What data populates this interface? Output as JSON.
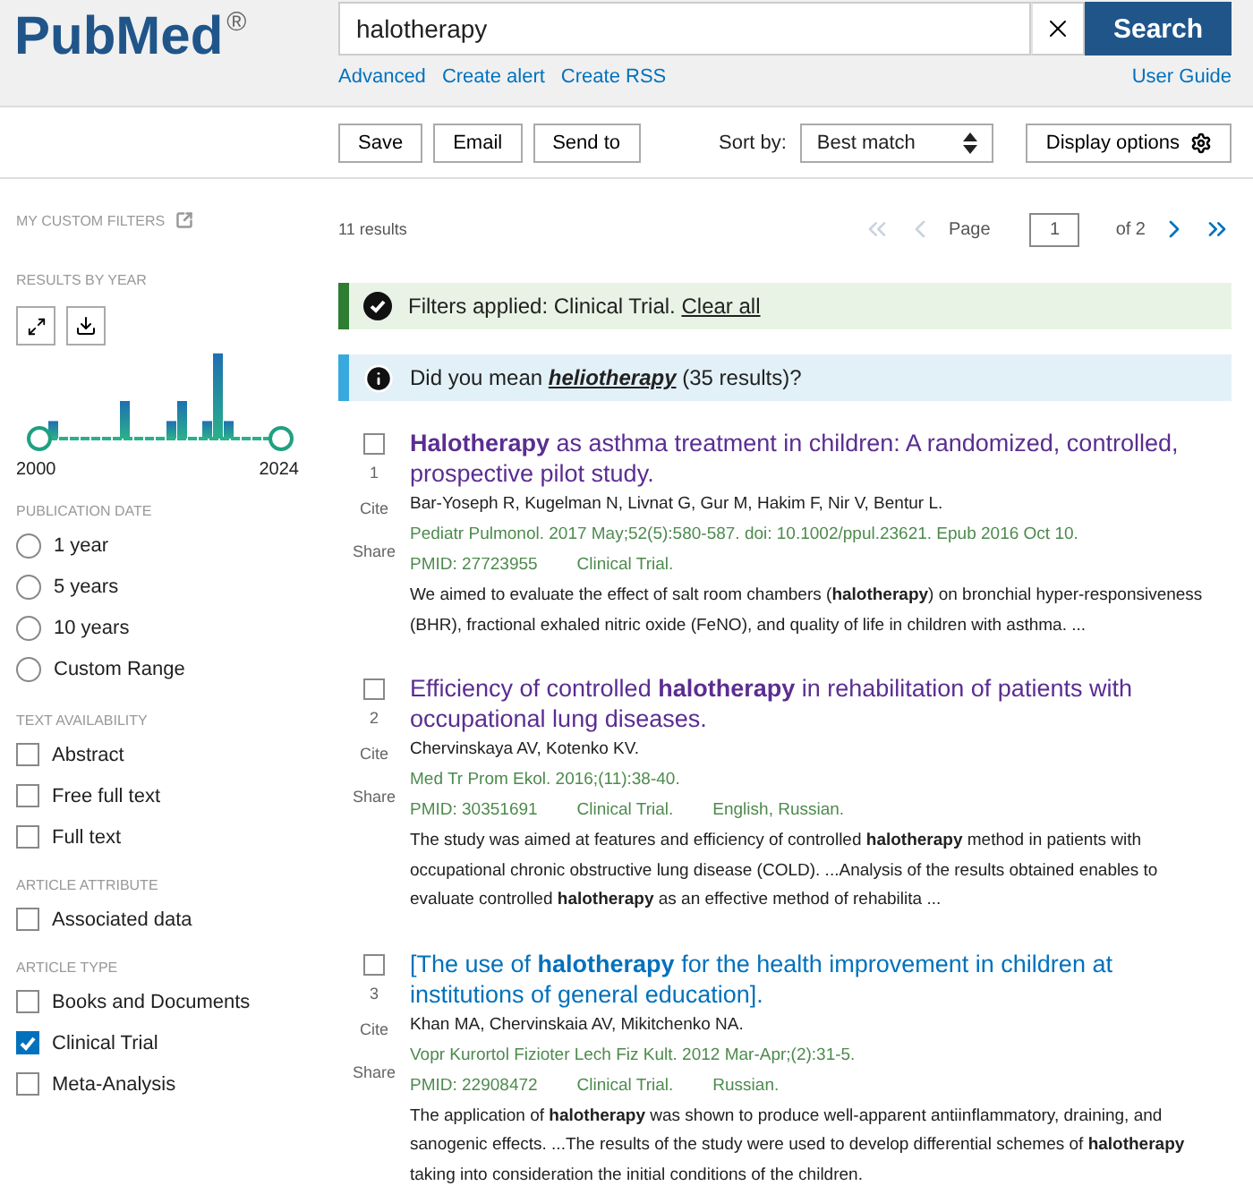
{
  "header": {
    "logo": "PubMed",
    "logo_mark": "®",
    "search": {
      "value": "halotherapy"
    },
    "search_button": "Search",
    "links": [
      "Advanced",
      "Create alert",
      "Create RSS"
    ],
    "user_guide": "User Guide"
  },
  "toolbar": {
    "buttons": [
      "Save",
      "Email",
      "Send to"
    ],
    "sort": {
      "label": "Sort by:",
      "value": "Best match"
    },
    "display_options": "Display options"
  },
  "sidebar": {
    "custom_filters": "MY CUSTOM FILTERS",
    "results_by_year": {
      "title": "RESULTS BY YEAR",
      "start": "2000",
      "end": "2024"
    },
    "sections": [
      {
        "title": "PUBLICATION DATE",
        "kind": "radio",
        "items": [
          {
            "label": "1 year",
            "selected": false
          },
          {
            "label": "5 years",
            "selected": false
          },
          {
            "label": "10 years",
            "selected": false
          },
          {
            "label": "Custom Range",
            "selected": false
          }
        ]
      },
      {
        "title": "TEXT AVAILABILITY",
        "kind": "checkbox",
        "items": [
          {
            "label": "Abstract",
            "checked": false
          },
          {
            "label": "Free full text",
            "checked": false
          },
          {
            "label": "Full text",
            "checked": false
          }
        ]
      },
      {
        "title": "ARTICLE ATTRIBUTE",
        "kind": "checkbox",
        "items": [
          {
            "label": "Associated data",
            "checked": false
          }
        ]
      },
      {
        "title": "ARTICLE TYPE",
        "kind": "checkbox",
        "items": [
          {
            "label": "Books and Documents",
            "checked": false
          },
          {
            "label": "Clinical Trial",
            "checked": true
          },
          {
            "label": "Meta-Analysis",
            "checked": false
          }
        ]
      }
    ]
  },
  "main": {
    "results_count": "11 results",
    "pagination": {
      "label": "Page",
      "value": "1",
      "total": "of 2",
      "first_disabled": true,
      "last_disabled": false
    },
    "filters_notice": {
      "text": "Filters applied: Clinical Trial.",
      "link": "Clear all"
    },
    "suggestion": {
      "before": "Did you mean",
      "term": "heliotherapy",
      "after": "(35 results)?"
    },
    "results": [
      {
        "number": "1",
        "selected": false,
        "visited": true,
        "title": "**Halotherapy** as asthma treatment in children: A randomized, controlled, prospective pilot study.",
        "authors": "Bar-Yoseph R, Kugelman N, Livnat G, Gur M, Hakim F, Nir V, Bentur L.",
        "citation": "Pediatr Pulmonol. 2017 May;52(5):580-587. doi: 10.1002/ppul.23621. Epub 2016 Oct 10.",
        "tags": [
          "PMID: 27723955",
          "Clinical Trial."
        ],
        "snippet": "We aimed to evaluate the effect of salt room chambers (**halotherapy**) on bronchial hyper-responsiveness (BHR), fractional exhaled nitric oxide (FeNO), and quality of life in children with asthma. ...",
        "actions": [
          "Cite",
          "Share"
        ]
      },
      {
        "number": "2",
        "selected": false,
        "visited": true,
        "title": "Efficiency of controlled **halotherapy** in rehabilitation of patients with occupational lung diseases.",
        "authors": "Chervinskaya AV, Kotenko KV.",
        "citation": "Med Tr Prom Ekol. 2016;(11):38-40.",
        "tags": [
          "PMID: 30351691",
          "Clinical Trial.",
          "English, Russian."
        ],
        "snippet": "The study was aimed at features and efficiency of controlled **halotherapy** method in patients with occupational chronic obstructive lung disease (COLD). ...Analysis of the results obtained enables to evaluate controlled **halotherapy** as an effective method of rehabilita ...",
        "actions": [
          "Cite",
          "Share"
        ]
      },
      {
        "number": "3",
        "selected": false,
        "visited": false,
        "title": "[The use of **halotherapy** for the health improvement in children at institutions of general education].",
        "authors": "Khan MA, Chervinskaia AV, Mikitchenko NA.",
        "citation": "Vopr Kurortol Fizioter Lech Fiz Kult. 2012 Mar-Apr;(2):31-5.",
        "tags": [
          "PMID: 22908472",
          "Clinical Trial.",
          "Russian."
        ],
        "snippet": "The application of **halotherapy** was shown to produce well-apparent antiinflammatory, draining, and sanogenic effects. ...The results of the study were used to develop differential schemes of **halotherapy** taking into consideration the initial conditions of the children.",
        "actions": [
          "Cite",
          "Share"
        ]
      }
    ]
  }
}
